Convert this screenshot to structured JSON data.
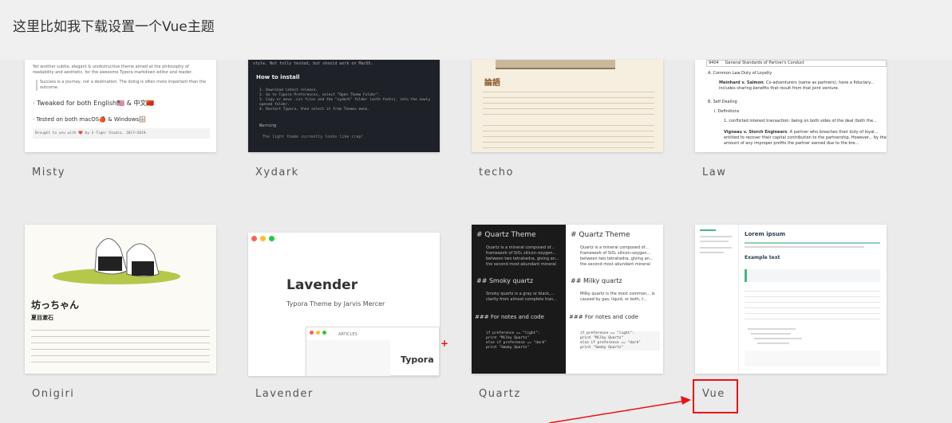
{
  "intro_text": "这里比如我下载设置一个Vue主题",
  "themes": [
    {
      "name": "Misty"
    },
    {
      "name": "Xydark"
    },
    {
      "name": "techo"
    },
    {
      "name": "Law"
    },
    {
      "name": "Onigiri"
    },
    {
      "name": "Lavender"
    },
    {
      "name": "Quartz"
    },
    {
      "name": "Vue"
    }
  ],
  "misty": {
    "p1": "Yet another subtle, elegant & unobstructive theme aimed at the philosophy of readability and aesthetic, for the awesome Typora markdown editor and reader.",
    "quote": "Success is a journey, not a destination. The doing is often more important than the outcome.",
    "b1": "· Tweaked for both English🇺🇸 & 中文🇨🇳",
    "b2": "· Tested on both macOS🍎 & Windows🪟",
    "footer": "Brought to you with ❤️ by S-Tiger Studio, 2017~2019."
  },
  "xydark": {
    "top": "style. Not fully tested, but should work on MacOS.",
    "heading": "How to install",
    "steps": [
      "1. Download latest release.",
      "2. Go to Typora Preferences, select \"Open Theme Folder\".",
      "3. Copy or move .css files and the \"xydark\" folder (with fonts), into the newly opened folder.",
      "4. Restart Typora, then select it from Themes menu."
    ],
    "warn": "Warning",
    "warn_text": "The light theme currently looks like crap!"
  },
  "techo": {
    "heading": "論語"
  },
  "law": {
    "row_code": "9404",
    "row_text": "General Standards of Partner's Conduct",
    "a": "A. Common Law Duty of Loyalty",
    "case1_name": "Meinhard v. Salmon",
    "case1": ": Co-adventurers (same as partners), have a fiduciary... includes sharing benefits that result from that joint venture.",
    "b": "B. Self Dealing",
    "defs": "i. Definitions",
    "def1": "1. conflicted interest transaction: being on both sides of the deal (both the...",
    "case2_name": "Vigneau v. Storch Engineers",
    "case2": ": A partner who breaches their duty of loyal... entitled to recover their capital contribution to the partnership. However... by the amount of any improper profits the partner earned due to the bre..."
  },
  "onigiri": {
    "title": "坊っちゃん",
    "author": "夏目漱石"
  },
  "lavender": {
    "title": "Lavender",
    "subtitle": "Typora Theme by Jarvis Mercer",
    "articles": "ARTICLES",
    "typora": "Typora"
  },
  "quartz": {
    "title": "Quartz Theme",
    "intro": "Quartz is a mineral composed of... framework of SiO₄ silicon–oxygen... between two tetrahedra, giving an... the second most abundant mineral",
    "h2": "Smoky quartz",
    "smoky": "Smoky quartz is a gray or black,... clarity from almost complete tran...",
    "h2b": "Milky quartz",
    "milky": "Milky quartz is the most common... is caused by gas, liquid, or both, t...",
    "h3": "For notes and code",
    "code": [
      "if preference == \"light\":",
      "  print \"Milky Quartz\"",
      "else if preference == \"dark\"",
      "  print \"Smoky Quartz\""
    ]
  },
  "vue": {
    "title": "Lorem ipsum",
    "h2": "Example text"
  },
  "colors": {
    "annotation": "#e11111",
    "vue_accent": "#42b983",
    "lavender_accent": "#b8a6d9"
  }
}
